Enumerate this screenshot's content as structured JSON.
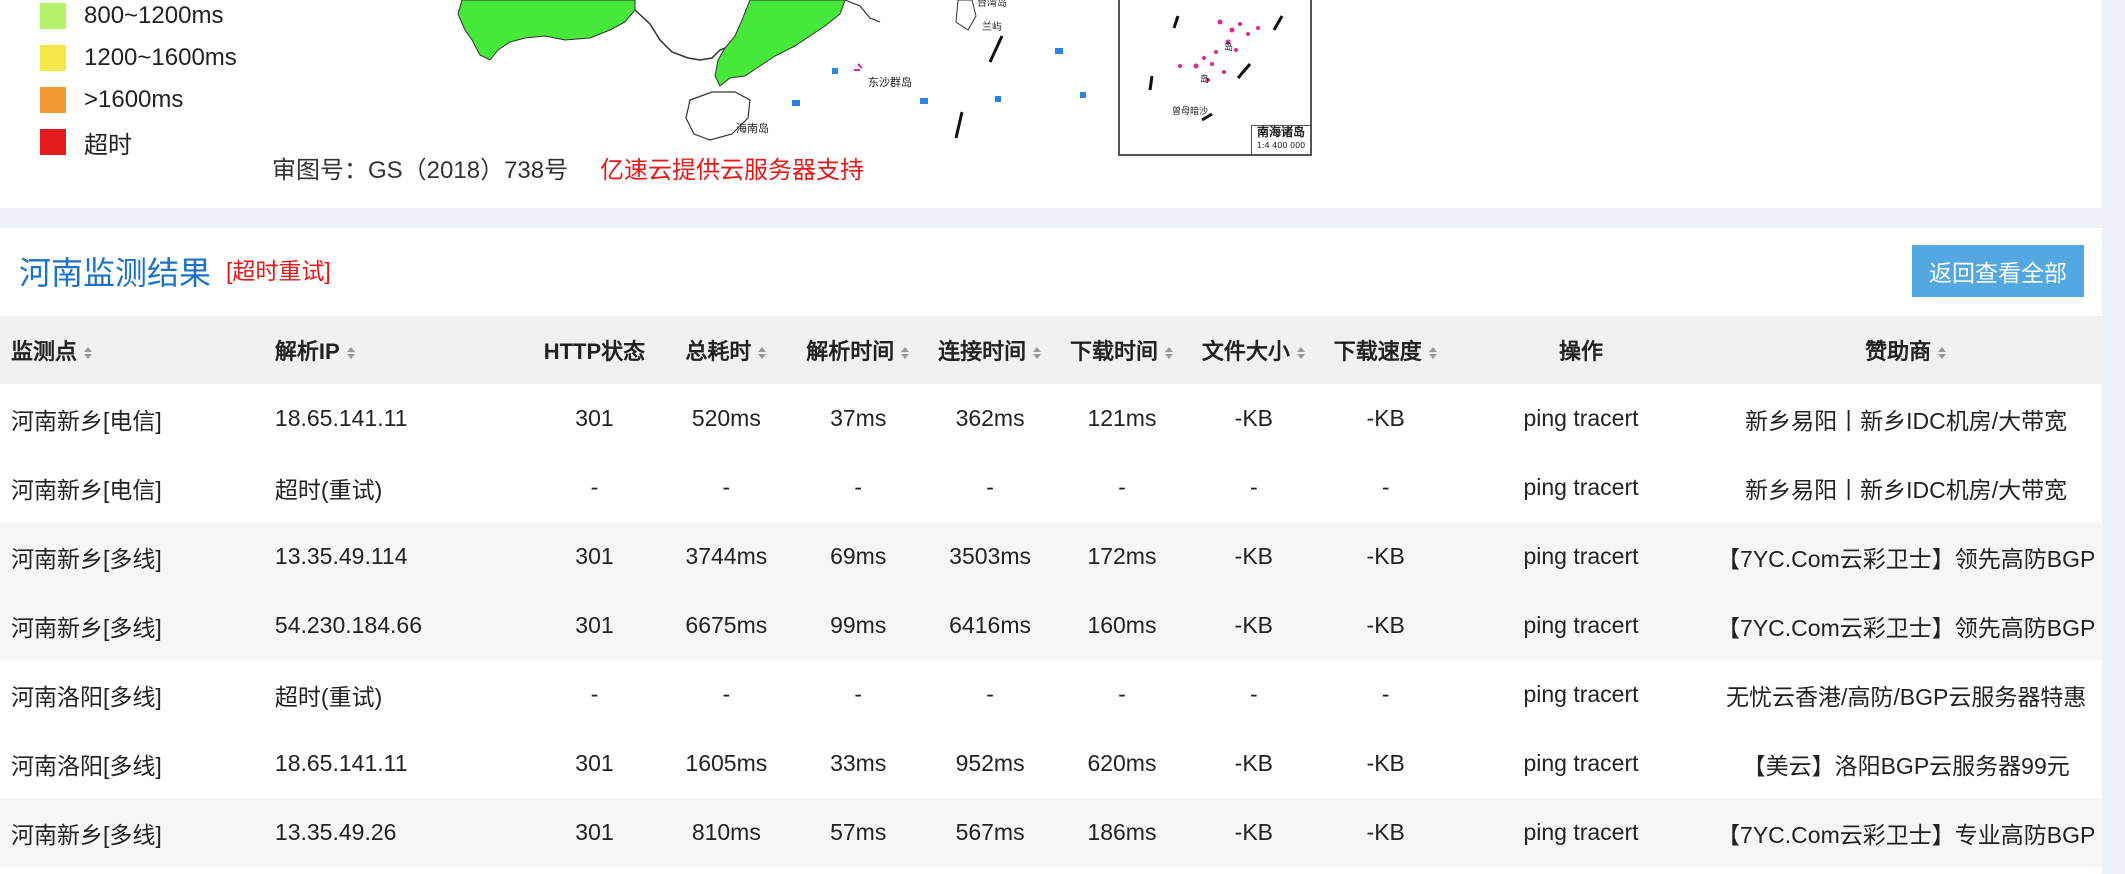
{
  "legend": [
    {
      "label": "800~1200ms",
      "color": "#b4f26a"
    },
    {
      "label": "1200~1600ms",
      "color": "#f4e947"
    },
    {
      "label": ">1600ms",
      "color": "#f39a35"
    },
    {
      "label": "超时",
      "color": "#e21b1b"
    }
  ],
  "map": {
    "caption": "审图号：GS（2018）738号",
    "sponsor": "亿速云提供云服务器支持",
    "inset_label": "南海诸岛\n1:4 400 000"
  },
  "result": {
    "title": "河南监测结果",
    "retry_label": "[超时重试]",
    "back_button": "返回查看全部",
    "headers": {
      "node": "监测点",
      "ip": "解析IP",
      "http": "HTTP状态",
      "total": "总耗时",
      "dns": "解析时间",
      "connect": "连接时间",
      "download": "下载时间",
      "size": "文件大小",
      "speed": "下载速度",
      "ops": "操作",
      "sponsor": "赞助商"
    },
    "rows": [
      {
        "node": "河南新乡[电信]",
        "ip": "18.65.141.11",
        "http": "301",
        "total": "520ms",
        "dns": "37ms",
        "connect": "362ms",
        "download": "121ms",
        "size": "-KB",
        "speed": "-KB",
        "ops": "ping tracert",
        "sponsor": "新乡易阳丨新乡IDC机房/大带宽"
      },
      {
        "node": "河南新乡[电信]",
        "ip": "超时(重试)",
        "http": "-",
        "total": "-",
        "dns": "-",
        "connect": "-",
        "download": "-",
        "size": "-",
        "speed": "-",
        "ops": "ping tracert",
        "sponsor": "新乡易阳丨新乡IDC机房/大带宽"
      },
      {
        "node": "河南新乡[多线]",
        "ip": "13.35.49.114",
        "http": "301",
        "total": "3744ms",
        "dns": "69ms",
        "connect": "3503ms",
        "download": "172ms",
        "size": "-KB",
        "speed": "-KB",
        "ops": "ping tracert",
        "sponsor": "【7YC.Com云彩卫士】领先高防BGP"
      },
      {
        "node": "河南新乡[多线]",
        "ip": "54.230.184.66",
        "http": "301",
        "total": "6675ms",
        "dns": "99ms",
        "connect": "6416ms",
        "download": "160ms",
        "size": "-KB",
        "speed": "-KB",
        "ops": "ping tracert",
        "sponsor": "【7YC.Com云彩卫士】领先高防BGP"
      },
      {
        "node": "河南洛阳[多线]",
        "ip": "超时(重试)",
        "http": "-",
        "total": "-",
        "dns": "-",
        "connect": "-",
        "download": "-",
        "size": "-",
        "speed": "-",
        "ops": "ping tracert",
        "sponsor": "无忧云香港/高防/BGP云服务器特惠"
      },
      {
        "node": "河南洛阳[多线]",
        "ip": "18.65.141.11",
        "http": "301",
        "total": "1605ms",
        "dns": "33ms",
        "connect": "952ms",
        "download": "620ms",
        "size": "-KB",
        "speed": "-KB",
        "ops": "ping tracert",
        "sponsor": "【美云】洛阳BGP云服务器99元"
      },
      {
        "node": "河南新乡[多线]",
        "ip": "13.35.49.26",
        "http": "301",
        "total": "810ms",
        "dns": "57ms",
        "connect": "567ms",
        "download": "186ms",
        "size": "-KB",
        "speed": "-KB",
        "ops": "ping tracert",
        "sponsor": "【7YC.Com云彩卫士】专业高防BGP"
      }
    ],
    "highlight_color": "#e81818",
    "link_color": "#3d87d6"
  }
}
